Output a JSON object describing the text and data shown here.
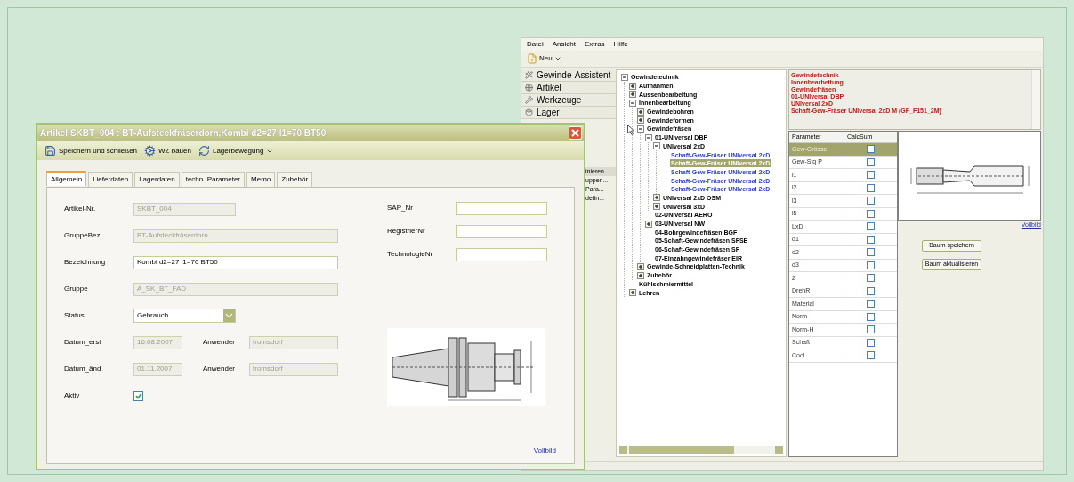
{
  "back_window": {
    "menu": [
      "Datei",
      "Ansicht",
      "Extras",
      "Hilfe"
    ],
    "toolbar": {
      "new_button": "Neu"
    },
    "sidebar": {
      "nav": [
        {
          "label": "Gewinde-Assistent",
          "kind": "wizard"
        },
        {
          "label": "Artikel",
          "kind": "globe"
        },
        {
          "label": "Werkzeuge",
          "kind": "tools"
        },
        {
          "label": "Lager",
          "kind": "box"
        }
      ],
      "list": [
        {
          "label": "inieren",
          "selected": true
        },
        {
          "label": "uppen...",
          "selected": false
        },
        {
          "label": "Para...",
          "selected": false
        },
        {
          "label": "defin...",
          "selected": false
        }
      ]
    },
    "tree": [
      {
        "label": "Gewindetechnik",
        "kind": "folder",
        "expanded": true,
        "selected": false,
        "children": [
          {
            "label": "Aufnahmen",
            "kind": "folder",
            "expanded": false,
            "selected": false
          },
          {
            "label": "Aussenbearbeitung",
            "kind": "folder",
            "expanded": false,
            "selected": false
          },
          {
            "label": "Innenbearbeitung",
            "kind": "folder",
            "expanded": true,
            "selected": false,
            "children": [
              {
                "label": "Gewindebohren",
                "kind": "folder",
                "expanded": false,
                "selected": false
              },
              {
                "label": "Gewindeformen",
                "kind": "folder",
                "expanded": false,
                "selected": false
              },
              {
                "label": "Gewindefräsen",
                "kind": "folder",
                "expanded": true,
                "selected": false,
                "children": [
                  {
                    "label": "01-UNIversal DBP",
                    "kind": "folder",
                    "expanded": true,
                    "selected": false,
                    "children": [
                      {
                        "label": "UNIversal 2xD",
                        "kind": "folder",
                        "expanded": true,
                        "selected": false,
                        "children": [
                          {
                            "label": "Schaft-Gew-Fräser UNIversal 2xD",
                            "kind": "item",
                            "selected": false
                          },
                          {
                            "label": "Schaft-Gew-Fräser UNIversal 2xD",
                            "kind": "item",
                            "selected": true
                          },
                          {
                            "label": "Schaft-Gew-Fräser UNIversal 2xD",
                            "kind": "item",
                            "selected": false
                          },
                          {
                            "label": "Schaft-Gew-Fräser UNIversal 2xD",
                            "kind": "item",
                            "selected": false
                          },
                          {
                            "label": "Schaft-Gew-Fräser UNIversal 2xD",
                            "kind": "item",
                            "selected": false
                          }
                        ]
                      },
                      {
                        "label": "UNIversal 2xD OSM",
                        "kind": "folder",
                        "expanded": false,
                        "selected": false
                      },
                      {
                        "label": "UNIversal 3xD",
                        "kind": "folder",
                        "expanded": false,
                        "selected": false
                      }
                    ]
                  },
                  {
                    "label": "02-UNIversal AERO",
                    "kind": "leaf",
                    "selected": false
                  },
                  {
                    "label": "03-UNIversal NW",
                    "kind": "folder",
                    "expanded": false,
                    "selected": false
                  },
                  {
                    "label": "04-Bohrgewindefräsen BGF",
                    "kind": "leaf",
                    "selected": false
                  },
                  {
                    "label": "05-Schaft-Gewindefräsen SFSE",
                    "kind": "leaf",
                    "selected": false
                  },
                  {
                    "label": "06-Schaft-Gewindefräsen SF",
                    "kind": "leaf",
                    "selected": false
                  },
                  {
                    "label": "07-Einzahngewindefräser EIR",
                    "kind": "leaf",
                    "selected": false
                  }
                ]
              },
              {
                "label": "Gewinde-Schneidplatten-Technik",
                "kind": "folder",
                "expanded": false,
                "selected": false
              },
              {
                "label": "Zubehör",
                "kind": "folder",
                "expanded": false,
                "selected": false
              }
            ]
          },
          {
            "label": "Kühlschmiermittel",
            "kind": "leaf",
            "selected": false
          },
          {
            "label": "Lehren",
            "kind": "folder",
            "expanded": false,
            "selected": false
          }
        ]
      }
    ],
    "path_lines": [
      "Gewindetechnik",
      "Innenbearbeitung",
      "Gewindefräsen",
      "01-UNIversal DBP",
      "UNIversal 2xD",
      "Schaft-Gew-Fräser UNIversal 2xD M (GF_F151_2M)"
    ],
    "table": {
      "columns": [
        "Parameter",
        "CalcSum"
      ],
      "rows": [
        {
          "name": "Gew-Grösse",
          "checked": false,
          "selected": true
        },
        {
          "name": "Gew-Stg P",
          "checked": false,
          "selected": false
        },
        {
          "name": "l1",
          "checked": false,
          "selected": false
        },
        {
          "name": "l2",
          "checked": false,
          "selected": false
        },
        {
          "name": "l3",
          "checked": false,
          "selected": false
        },
        {
          "name": "l5",
          "checked": false,
          "selected": false
        },
        {
          "name": "LxD",
          "checked": false,
          "selected": false
        },
        {
          "name": "d1",
          "checked": false,
          "selected": false
        },
        {
          "name": "d2",
          "checked": false,
          "selected": false
        },
        {
          "name": "d3",
          "checked": false,
          "selected": false
        },
        {
          "name": "Z",
          "checked": false,
          "selected": false
        },
        {
          "name": "DrehR",
          "checked": false,
          "selected": false
        },
        {
          "name": "Material",
          "checked": false,
          "selected": false
        },
        {
          "name": "Norm",
          "checked": false,
          "selected": false
        },
        {
          "name": "Norm-H",
          "checked": false,
          "selected": false
        },
        {
          "name": "Schaft",
          "checked": false,
          "selected": false
        },
        {
          "name": "Cool",
          "checked": false,
          "selected": false
        }
      ]
    },
    "image_link": "Vollbild",
    "buttons": [
      "Baum speichern",
      "Baum aktualisieren"
    ]
  },
  "dialog": {
    "title": "Artikel SKBT_004 : BT-Aufsteckfräserdorn,Kombi d2=27 l1=70 BT50",
    "toolbar": [
      {
        "label": "Speichern und schließen",
        "kind": "save",
        "menu": false
      },
      {
        "label": "WZ bauen",
        "kind": "build",
        "menu": false
      },
      {
        "label": "Lagerbewegung",
        "kind": "move",
        "menu": true
      }
    ],
    "tabs": [
      {
        "label": "Allgemein",
        "selected": true
      },
      {
        "label": "Lieferdaten",
        "selected": false
      },
      {
        "label": "Lagerdaten",
        "selected": false
      },
      {
        "label": "techn. Parameter",
        "selected": false
      },
      {
        "label": "Memo",
        "selected": false
      },
      {
        "label": "Zubehör",
        "selected": false
      }
    ],
    "form_left": [
      {
        "kind": "text",
        "label": "Artikel-Nr.",
        "value": "SKBT_004",
        "disabled": true
      },
      {
        "kind": "text",
        "label": "GruppeBez",
        "value": "BT-Aufsteckfräserdorn",
        "disabled": true
      },
      {
        "kind": "text",
        "label": "Bezeichnung",
        "value": "Kombi d2=27 l1=70 BT50",
        "disabled": false
      },
      {
        "kind": "text",
        "label": "Gruppe",
        "value": "A_SK_BT_FAD",
        "disabled": true
      },
      {
        "kind": "select",
        "label": "Status",
        "value": "Gebrauch"
      },
      {
        "kind": "date",
        "label": "Datum_erst",
        "value": "16.08.2007",
        "disabled": true,
        "user_label": "Anwender",
        "user": "tromsdorf"
      },
      {
        "kind": "date",
        "label": "Datum_änd",
        "value": "01.11.2007",
        "disabled": true,
        "user_label": "Anwender",
        "user": "tromsdorf"
      },
      {
        "kind": "checkbox",
        "label": "Aktiv",
        "checked": true
      }
    ],
    "form_right": [
      {
        "label": "SAP_Nr"
      },
      {
        "label": "RegistrierNr"
      },
      {
        "label": "TechnologieNr"
      }
    ],
    "image_link": "Vollbild"
  }
}
